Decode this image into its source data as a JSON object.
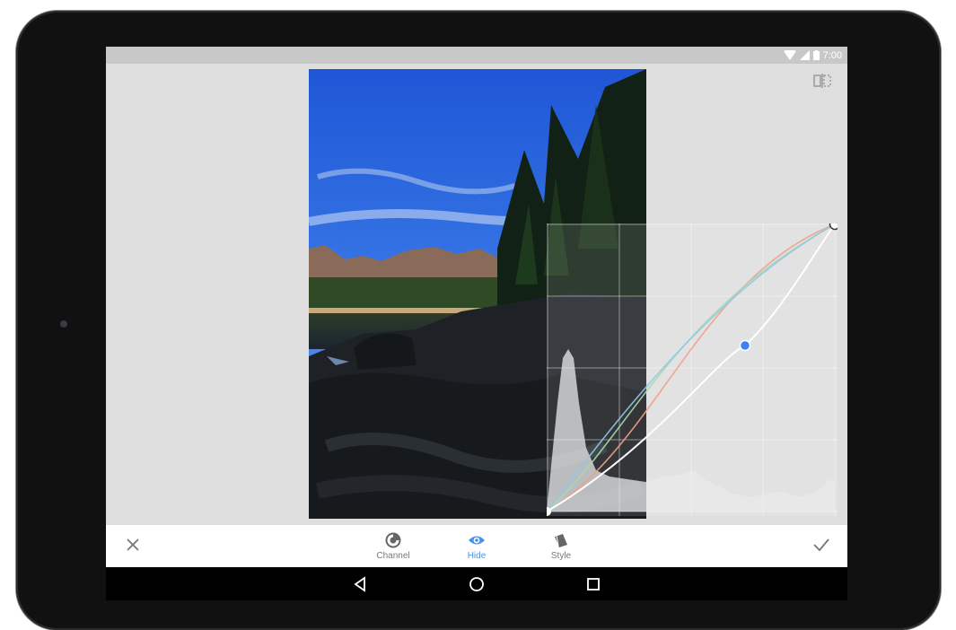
{
  "status_bar": {
    "time": "7:00"
  },
  "toolbar": {
    "tools": [
      {
        "label": "Channel",
        "icon": "channel-icon",
        "active": false
      },
      {
        "label": "Hide",
        "icon": "eye-icon",
        "active": true
      },
      {
        "label": "Style",
        "icon": "style-icon",
        "active": false
      }
    ]
  },
  "colors": {
    "accent": "#4a90e2",
    "control_point": "#3b82f6"
  }
}
